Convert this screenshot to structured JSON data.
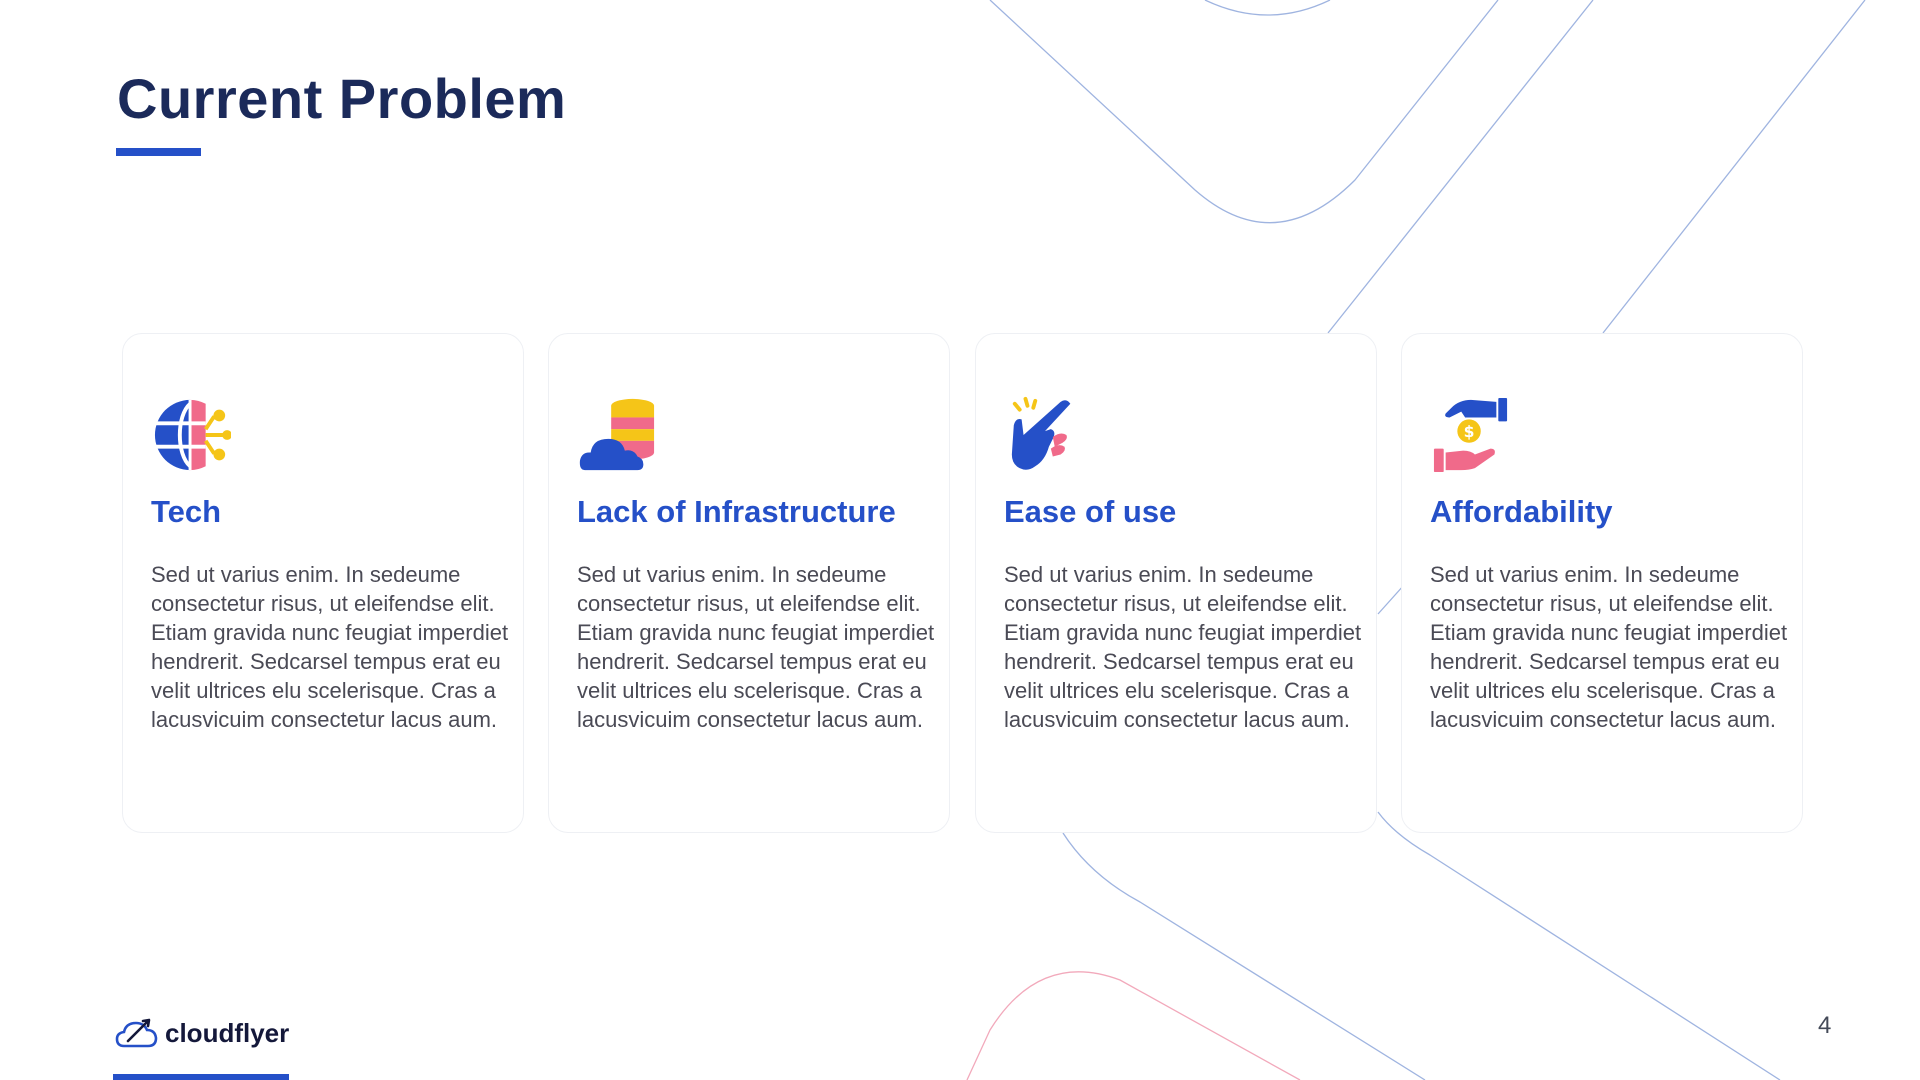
{
  "slide": {
    "title": "Current Problem",
    "page_number": "4"
  },
  "colors": {
    "accent": "#2550c8",
    "title": "#1b2a5a",
    "body_text": "#4a4a55",
    "pink": "#f06a8a",
    "yellow": "#f5c518",
    "line_blue": "#9fb4e0",
    "line_pink": "#f2a9bb"
  },
  "cards": [
    {
      "icon": "globe-network-icon",
      "title": "Tech",
      "body": "Sed ut varius enim. In sedeume consectetur risus, ut eleifendse elit. Etiam gravida nunc feugiat imperdiet hendrerit. Sedcarsel tempus erat eu velit ultrices elu scelerisque. Cras a lacusvicuim consectetur lacus aum."
    },
    {
      "icon": "cloud-database-icon",
      "title": "Lack of Infrastructure",
      "body": "Sed ut varius enim. In sedeume consectetur risus, ut eleifendse elit. Etiam gravida nunc feugiat imperdiet hendrerit. Sedcarsel tempus erat eu velit ultrices elu scelerisque. Cras a lacusvicuim consectetur lacus aum."
    },
    {
      "icon": "finger-snap-icon",
      "title": "Ease of use",
      "body": "Sed ut varius enim. In sedeume consectetur risus, ut eleifendse elit. Etiam gravida nunc feugiat imperdiet hendrerit. Sedcarsel tempus erat eu velit ultrices elu scelerisque. Cras a lacusvicuim consectetur lacus aum."
    },
    {
      "icon": "hand-coin-icon",
      "title": "Affordability",
      "body": "Sed ut varius enim. In sedeume consectetur risus, ut eleifendse elit. Etiam gravida nunc feugiat imperdiet hendrerit. Sedcarsel tempus erat eu velit ultrices elu scelerisque. Cras a lacusvicuim consectetur lacus aum."
    }
  ],
  "footer": {
    "logo_icon": "cloud-plane-icon",
    "brand_name": "cloudflyer"
  }
}
